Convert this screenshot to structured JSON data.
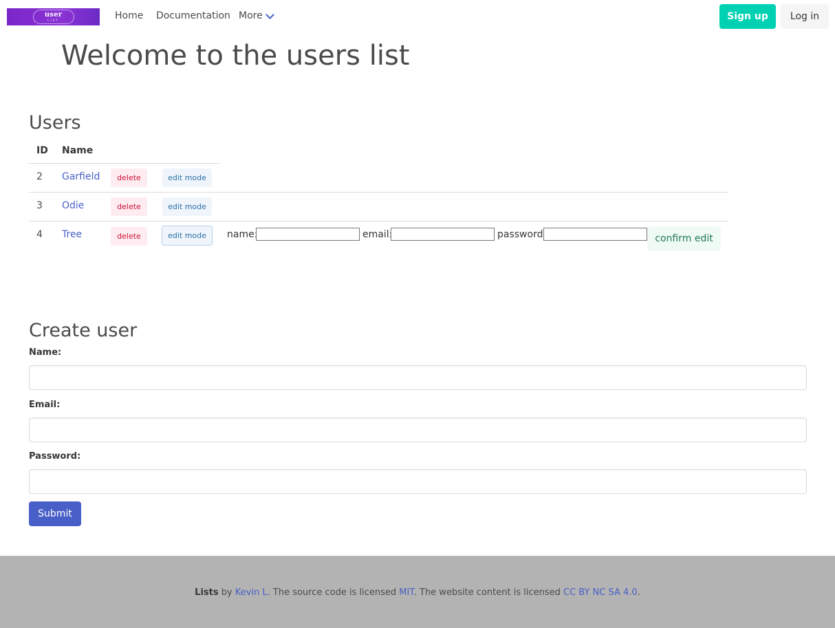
{
  "navbar": {
    "brand_word": "user",
    "brand_sub": "LIST",
    "links": [
      "Home",
      "Documentation",
      "More"
    ],
    "signup_label": "Sign up",
    "login_label": "Log in",
    "accent_color": "#485fc7",
    "signup_color": "#00d1b2",
    "brand_color": "#7a26c9"
  },
  "page_title": "Welcome to the users list",
  "users": {
    "heading": "Users",
    "columns": [
      "ID",
      "Name"
    ],
    "rows": [
      {
        "id": "2",
        "name": "Garfield",
        "delete_label": "delete",
        "edit_label": "edit mode"
      },
      {
        "id": "3",
        "name": "Odie",
        "delete_label": "delete",
        "edit_label": "edit mode"
      },
      {
        "id": "4",
        "name": "Tree",
        "delete_label": "delete",
        "edit_label": "edit mode"
      }
    ],
    "edit_form": {
      "name_label": "name:",
      "email_label": "email:",
      "password_label": "password:",
      "name_value": "",
      "email_value": "",
      "password_value": "",
      "confirm_label": "confirm edit"
    }
  },
  "create_user": {
    "heading": "Create user",
    "name_label": "Name:",
    "email_label": "Email:",
    "password_label": "Password:",
    "name_value": "",
    "email_value": "",
    "password_value": "",
    "submit_label": "Submit"
  },
  "footer": {
    "project": "Lists",
    "by": "by",
    "author": "Kevin L",
    "source_text": ". The source code is licensed",
    "source_license": "MIT",
    "content_text": ". The website content is licensed",
    "content_license": "CC BY NC SA 4.0",
    "end": "."
  }
}
